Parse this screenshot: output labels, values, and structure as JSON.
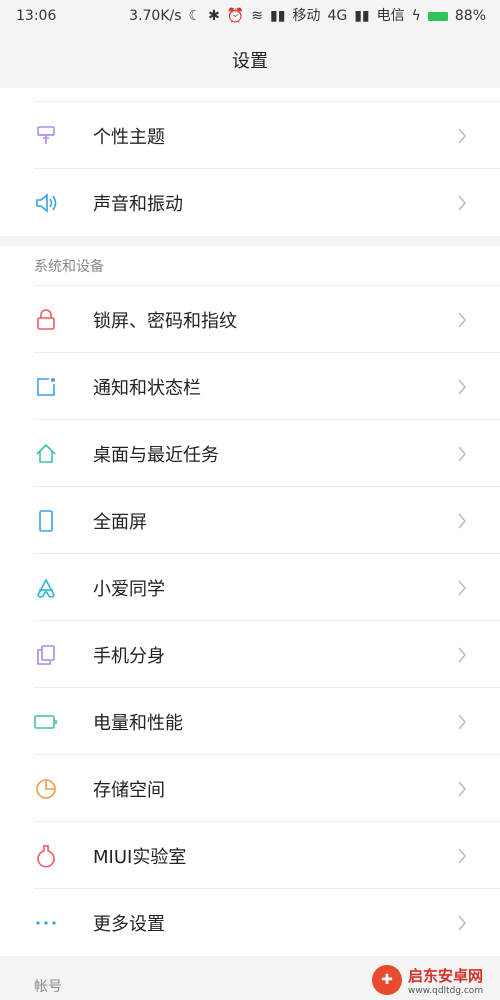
{
  "status_bar": {
    "time": "13:06",
    "speed": "3.70K/s",
    "carrier1": "移动",
    "network": "4G",
    "carrier2": "电信",
    "battery": "88%"
  },
  "header": {
    "title": "设置"
  },
  "group1": {
    "items": [
      {
        "label": "个性主题",
        "icon": "theme-brush-icon",
        "color": "#b58ce6"
      },
      {
        "label": "声音和振动",
        "icon": "speaker-icon",
        "color": "#3aa1e8"
      }
    ]
  },
  "group2": {
    "header": "系统和设备",
    "items": [
      {
        "label": "锁屏、密码和指纹",
        "icon": "lock-icon",
        "color": "#ee5b62"
      },
      {
        "label": "通知和状态栏",
        "icon": "notification-icon",
        "color": "#3aa1e8"
      },
      {
        "label": "桌面与最近任务",
        "icon": "home-icon",
        "color": "#3ec2a6"
      },
      {
        "label": "全面屏",
        "icon": "phone-screen-icon",
        "color": "#3aa1e8"
      },
      {
        "label": "小爱同学",
        "icon": "xiaoai-icon",
        "color": "#2bb6d6"
      },
      {
        "label": "手机分身",
        "icon": "dual-space-icon",
        "color": "#a98be0"
      },
      {
        "label": "电量和性能",
        "icon": "battery-icon",
        "color": "#3ec2a6"
      },
      {
        "label": "存储空间",
        "icon": "storage-pie-icon",
        "color": "#f09a4d"
      },
      {
        "label": "MIUI实验室",
        "icon": "lab-flask-icon",
        "color": "#ee5b62"
      },
      {
        "label": "更多设置",
        "icon": "more-dots-icon",
        "color": "#3aa1e8"
      }
    ]
  },
  "group3": {
    "header": "帐号"
  },
  "watermark": {
    "name": "启东安卓网",
    "url": "www.qdltdg.com"
  }
}
